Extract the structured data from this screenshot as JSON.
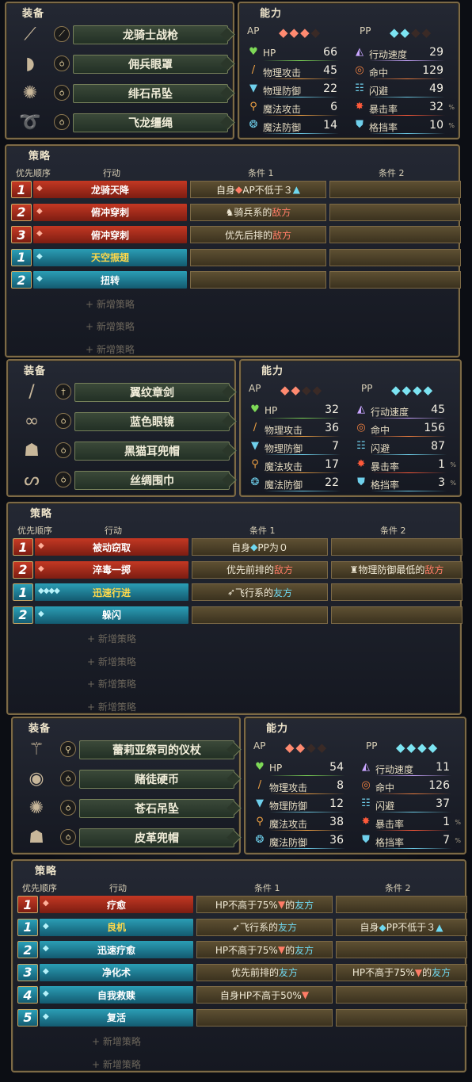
{
  "labels": {
    "equip_title": "装备",
    "ability_title": "能力",
    "strategy_title": "策略",
    "col_priority": "优先顺序",
    "col_action": "行动",
    "col_cond1": "条件 1",
    "col_cond2": "条件 2",
    "ap": "AP",
    "pp": "PP",
    "new_strategy": "+ 新增策略",
    "percent": "%"
  },
  "colors": {
    "ap_red": "#c43823",
    "pp_teal": "#2b9eb5",
    "enemy_text": "#ff7c66",
    "ally_text": "#6fd8f0",
    "frame_gold": "#7d6a46"
  },
  "characters": [
    {
      "equipment": [
        {
          "name": "龙骑士战枪",
          "slot_icon": "spear-slot-icon",
          "picture": "lance-icon"
        },
        {
          "name": "佣兵眼罩",
          "slot_icon": "ring-slot-icon",
          "picture": "eyepatch-icon"
        },
        {
          "name": "绯石吊坠",
          "slot_icon": "ring-slot-icon",
          "picture": "pendant-icon"
        },
        {
          "name": "飞龙缰绳",
          "slot_icon": "ring-slot-icon",
          "picture": "reins-icon"
        }
      ],
      "ap": {
        "filled": 3,
        "total": 4
      },
      "pp": {
        "filled": 2,
        "total": 4
      },
      "stats_left": [
        {
          "label": "HP",
          "value": "66",
          "icon": "heart-icon"
        },
        {
          "label": "物理攻击",
          "value": "45",
          "icon": "sword-icon"
        },
        {
          "label": "物理防御",
          "value": "22",
          "icon": "armor-icon"
        },
        {
          "label": "魔法攻击",
          "value": "6",
          "icon": "staff-icon"
        },
        {
          "label": "魔法防御",
          "value": "14",
          "icon": "magic-shield-icon"
        }
      ],
      "stats_right": [
        {
          "label": "行动速度",
          "value": "29",
          "icon": "speed-icon"
        },
        {
          "label": "命中",
          "value": "129",
          "icon": "target-icon"
        },
        {
          "label": "闪避",
          "value": "49",
          "icon": "evade-icon"
        },
        {
          "label": "暴击率",
          "value": "32",
          "icon": "crit-icon",
          "unit": "%"
        },
        {
          "label": "格挡率",
          "value": "10",
          "icon": "shield-icon",
          "unit": "%"
        }
      ],
      "strategies": [
        {
          "num": "1",
          "kind": "ap",
          "cost": "◆",
          "action": "龙骑天降",
          "cond1": [
            {
              "t": "自身 "
            },
            {
              "t": "◆",
              "c": "apgem"
            },
            {
              "t": " AP不低于３ "
            },
            {
              "t": "▲",
              "c": "ally"
            }
          ],
          "cond2": []
        },
        {
          "num": "2",
          "kind": "ap",
          "cost": "◆",
          "action": "俯冲穿刺",
          "cond1": [
            {
              "t": "♞ "
            },
            {
              "t": "骑兵系的"
            },
            {
              "t": "敌方",
              "c": "enemy"
            }
          ],
          "cond2": []
        },
        {
          "num": "3",
          "kind": "ap",
          "cost": "◆",
          "action": "俯冲穿刺",
          "cond1": [
            {
              "t": "优先后排的"
            },
            {
              "t": "敌方",
              "c": "enemy"
            }
          ],
          "cond2": []
        },
        {
          "num": "1",
          "kind": "pp",
          "cost": "◆",
          "action": "天空振翅",
          "highlight": true,
          "cond1": [],
          "cond2": []
        },
        {
          "num": "2",
          "kind": "pp",
          "cost": "◆",
          "action": "扭转",
          "cond1": [],
          "cond2": []
        }
      ],
      "new_strategy_count": 3
    },
    {
      "equipment": [
        {
          "name": "翼纹章剑",
          "slot_icon": "sword-slot-icon",
          "picture": "sword-icon"
        },
        {
          "name": "蓝色眼镜",
          "slot_icon": "ring-slot-icon",
          "picture": "glasses-icon"
        },
        {
          "name": "黑猫耳兜帽",
          "slot_icon": "ring-slot-icon",
          "picture": "hood-icon"
        },
        {
          "name": "丝绸围巾",
          "slot_icon": "ring-slot-icon",
          "picture": "scarf-icon"
        }
      ],
      "ap": {
        "filled": 2,
        "total": 4
      },
      "pp": {
        "filled": 4,
        "total": 4
      },
      "stats_left": [
        {
          "label": "HP",
          "value": "32",
          "icon": "heart-icon"
        },
        {
          "label": "物理攻击",
          "value": "36",
          "icon": "sword-icon"
        },
        {
          "label": "物理防御",
          "value": "7",
          "icon": "armor-icon"
        },
        {
          "label": "魔法攻击",
          "value": "17",
          "icon": "staff-icon"
        },
        {
          "label": "魔法防御",
          "value": "22",
          "icon": "magic-shield-icon"
        }
      ],
      "stats_right": [
        {
          "label": "行动速度",
          "value": "45",
          "icon": "speed-icon"
        },
        {
          "label": "命中",
          "value": "156",
          "icon": "target-icon"
        },
        {
          "label": "闪避",
          "value": "87",
          "icon": "evade-icon"
        },
        {
          "label": "暴击率",
          "value": "1",
          "icon": "crit-icon",
          "unit": "%"
        },
        {
          "label": "格挡率",
          "value": "3",
          "icon": "shield-icon",
          "unit": "%"
        }
      ],
      "strategies": [
        {
          "num": "1",
          "kind": "ap",
          "cost": "◆",
          "action": "被动窃取",
          "cond1": [
            {
              "t": "自身 "
            },
            {
              "t": "◆",
              "c": "ppgem"
            },
            {
              "t": " PP为０"
            }
          ],
          "cond2": []
        },
        {
          "num": "2",
          "kind": "ap",
          "cost": "◆",
          "action": "淬毒一掷",
          "cond1": [
            {
              "t": "优先前排的"
            },
            {
              "t": "敌方",
              "c": "enemy"
            }
          ],
          "cond2": [
            {
              "t": "♜ "
            },
            {
              "t": "物理防御最低的"
            },
            {
              "t": "敌方",
              "c": "enemy"
            }
          ]
        },
        {
          "num": "1",
          "kind": "pp",
          "cost": "◆◆◆◆",
          "action": "迅速行进",
          "highlight": true,
          "cond1": [
            {
              "t": "➶ "
            },
            {
              "t": "飞行系的"
            },
            {
              "t": "友方",
              "c": "ally"
            }
          ],
          "cond2": []
        },
        {
          "num": "2",
          "kind": "pp",
          "cost": "◆",
          "action": "躲闪",
          "cond1": [],
          "cond2": []
        }
      ],
      "new_strategy_count": 4
    },
    {
      "equipment": [
        {
          "name": "蕾莉亚祭司的仪杖",
          "slot_icon": "staff-slot-icon",
          "picture": "scepter-icon"
        },
        {
          "name": "赌徒硬币",
          "slot_icon": "ring-slot-icon",
          "picture": "coin-icon"
        },
        {
          "name": "苍石吊坠",
          "slot_icon": "ring-slot-icon",
          "picture": "pendant-icon"
        },
        {
          "name": "皮革兜帽",
          "slot_icon": "ring-slot-icon",
          "picture": "hood-icon"
        }
      ],
      "ap": {
        "filled": 2,
        "total": 4
      },
      "pp": {
        "filled": 4,
        "total": 4
      },
      "stats_left": [
        {
          "label": "HP",
          "value": "54",
          "icon": "heart-icon"
        },
        {
          "label": "物理攻击",
          "value": "8",
          "icon": "sword-icon"
        },
        {
          "label": "物理防御",
          "value": "12",
          "icon": "armor-icon"
        },
        {
          "label": "魔法攻击",
          "value": "38",
          "icon": "staff-icon"
        },
        {
          "label": "魔法防御",
          "value": "36",
          "icon": "magic-shield-icon"
        }
      ],
      "stats_right": [
        {
          "label": "行动速度",
          "value": "11",
          "icon": "speed-icon"
        },
        {
          "label": "命中",
          "value": "126",
          "icon": "target-icon"
        },
        {
          "label": "闪避",
          "value": "37",
          "icon": "evade-icon"
        },
        {
          "label": "暴击率",
          "value": "1",
          "icon": "crit-icon",
          "unit": "%"
        },
        {
          "label": "格挡率",
          "value": "7",
          "icon": "shield-icon",
          "unit": "%"
        }
      ],
      "strategies": [
        {
          "num": "1",
          "kind": "ap",
          "cost": "◆",
          "action": "疗愈",
          "cond1": [
            {
              "t": "HP不高于75%"
            },
            {
              "t": "▼",
              "c": "enemy"
            },
            {
              "t": "的"
            },
            {
              "t": "友方",
              "c": "ally"
            }
          ],
          "cond2": []
        },
        {
          "num": "1",
          "kind": "pp",
          "cost": "◆",
          "action": "良机",
          "highlight": true,
          "cond1": [
            {
              "t": "➶ "
            },
            {
              "t": "飞行系的"
            },
            {
              "t": "友方",
              "c": "ally"
            }
          ],
          "cond2": [
            {
              "t": "自身 "
            },
            {
              "t": "◆",
              "c": "ppgem"
            },
            {
              "t": " PP不低于３ "
            },
            {
              "t": "▲",
              "c": "ally"
            }
          ]
        },
        {
          "num": "2",
          "kind": "pp",
          "cost": "◆",
          "action": "迅速疗愈",
          "cond1": [
            {
              "t": "HP不高于75%"
            },
            {
              "t": "▼",
              "c": "enemy"
            },
            {
              "t": "的"
            },
            {
              "t": "友方",
              "c": "ally"
            }
          ],
          "cond2": []
        },
        {
          "num": "3",
          "kind": "pp",
          "cost": "◆",
          "action": "净化术",
          "cond1": [
            {
              "t": "优先前排的"
            },
            {
              "t": "友方",
              "c": "ally"
            }
          ],
          "cond2": [
            {
              "t": "HP不高于75%"
            },
            {
              "t": "▼",
              "c": "enemy"
            },
            {
              "t": "的"
            },
            {
              "t": "友方",
              "c": "ally"
            }
          ]
        },
        {
          "num": "4",
          "kind": "pp",
          "cost": "◆",
          "action": "自我救赎",
          "cond1": [
            {
              "t": "自身HP不高于50%"
            },
            {
              "t": "▼",
              "c": "enemy"
            }
          ],
          "cond2": []
        },
        {
          "num": "5",
          "kind": "pp",
          "cost": "◆",
          "action": "复活",
          "cond1": [],
          "cond2": []
        }
      ],
      "new_strategy_count": 2
    }
  ]
}
